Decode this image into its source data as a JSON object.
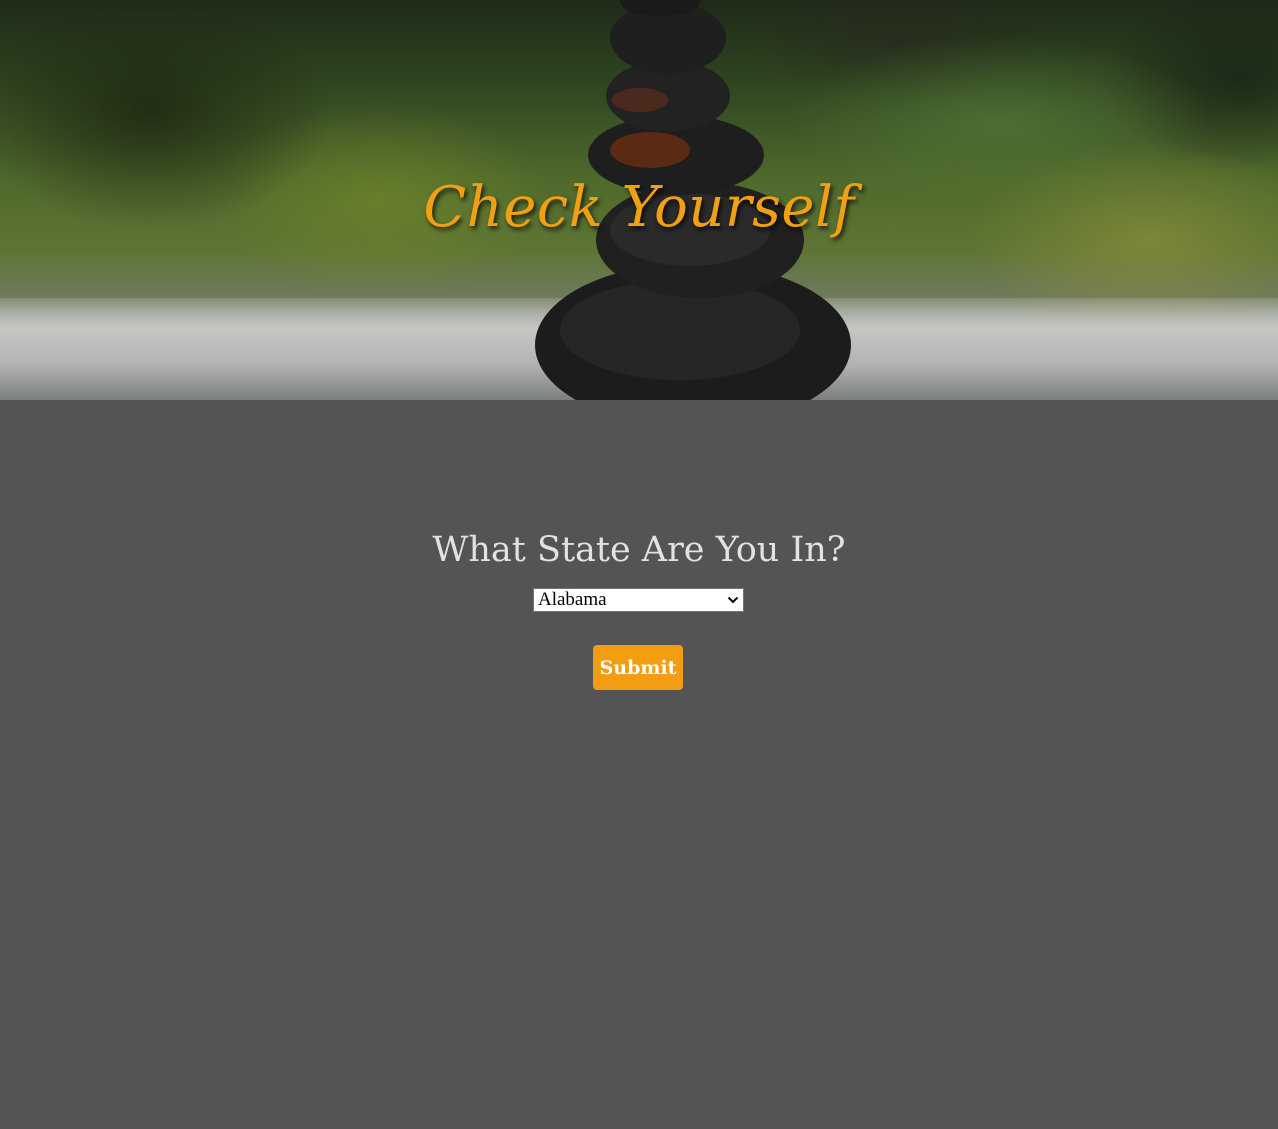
{
  "hero": {
    "title": "Check Yourself",
    "image_description_icon": "stacked-stones-photo",
    "title_color": "#f2a013"
  },
  "form": {
    "question": "What State Are You In?",
    "state_select": {
      "selected_value": "Alabama"
    },
    "submit_label": "Submit"
  },
  "colors": {
    "background": "#545454",
    "accent": "#f29d12",
    "question_text": "#e2e2e2"
  }
}
